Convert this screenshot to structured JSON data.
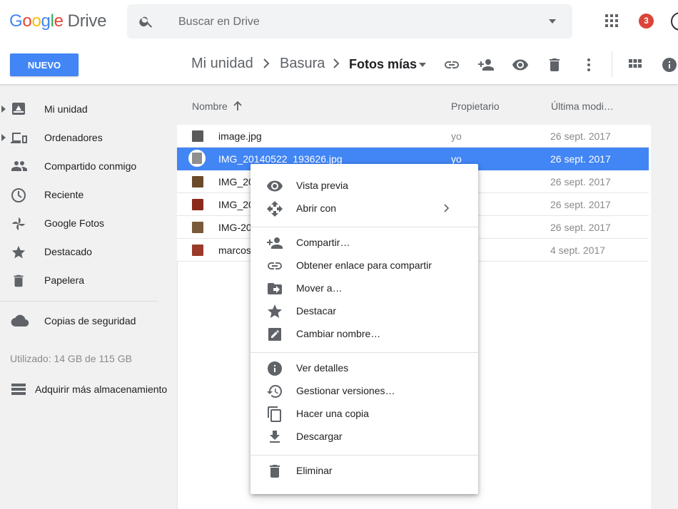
{
  "header": {
    "logo": {
      "google": "Google",
      "drive": "Drive",
      "colors": [
        "#4285f4",
        "#ea4335",
        "#fbbc05",
        "#4285f4",
        "#34a853",
        "#ea4335"
      ]
    },
    "search": {
      "placeholder": "Buscar en Drive",
      "icon": "search-icon"
    },
    "notifications": "3"
  },
  "toolbar": {
    "new_label": "NUEVO",
    "breadcrumb": [
      "Mi unidad",
      "Basura",
      "Fotos mías"
    ],
    "actions": [
      "link-icon",
      "share-person-icon",
      "preview-eye-icon",
      "trash-icon",
      "more-vert-icon",
      "grid-view-icon",
      "info-icon"
    ]
  },
  "sidebar": {
    "items": [
      {
        "label": "Mi unidad",
        "icon": "my-drive-icon"
      },
      {
        "label": "Ordenadores",
        "icon": "computers-icon"
      },
      {
        "label": "Compartido conmigo",
        "icon": "people-icon"
      },
      {
        "label": "Reciente",
        "icon": "clock-icon"
      },
      {
        "label": "Google Fotos",
        "icon": "pinwheel-icon"
      },
      {
        "label": "Destacado",
        "icon": "star-icon"
      },
      {
        "label": "Papelera",
        "icon": "trash-icon"
      }
    ],
    "backup": "Copias de seguridad",
    "storage_used": "Utilizado: 14 GB de 115 GB",
    "buy_storage": "Adquirir más almacenamiento"
  },
  "files": {
    "columns": {
      "name": "Nombre",
      "owner": "Propietario",
      "modified": "Última modi…"
    },
    "rows": [
      {
        "name": "image.jpg",
        "owner": "yo",
        "date": "26 sept. 2017",
        "thumb": "#5a5a5a"
      },
      {
        "name": "IMG_20140522_193626.jpg",
        "owner": "yo",
        "date": "26 sept. 2017",
        "thumb": "#8f8f8f",
        "selected": true
      },
      {
        "name": "IMG_20",
        "owner": "",
        "date": "26 sept. 2017",
        "thumb": "#6b4a2a"
      },
      {
        "name": "IMG_20",
        "owner": "",
        "date": "26 sept. 2017",
        "thumb": "#8a2a1a"
      },
      {
        "name": "IMG-20",
        "owner": "",
        "date": "26 sept. 2017",
        "thumb": "#7a5a3a"
      },
      {
        "name": "marcos",
        "owner": "",
        "date": "4 sept. 2017",
        "thumb": "#9a3a2a"
      }
    ]
  },
  "context_menu": {
    "items": [
      {
        "label": "Vista previa",
        "icon": "eye-icon"
      },
      {
        "label": "Abrir con",
        "icon": "move-arrows-icon",
        "submenu": true
      },
      {
        "label": "Compartir…",
        "icon": "add-person-icon"
      },
      {
        "label": "Obtener enlace para compartir",
        "icon": "link-icon"
      },
      {
        "label": "Mover a…",
        "icon": "folder-move-icon"
      },
      {
        "label": "Destacar",
        "icon": "star-icon"
      },
      {
        "label": "Cambiar nombre…",
        "icon": "rename-pencil-icon"
      },
      {
        "label": "Ver detalles",
        "icon": "info-icon"
      },
      {
        "label": "Gestionar versiones…",
        "icon": "history-icon"
      },
      {
        "label": "Hacer una copia",
        "icon": "copy-icon"
      },
      {
        "label": "Descargar",
        "icon": "download-icon"
      },
      {
        "label": "Eliminar",
        "icon": "trash-icon"
      }
    ]
  }
}
